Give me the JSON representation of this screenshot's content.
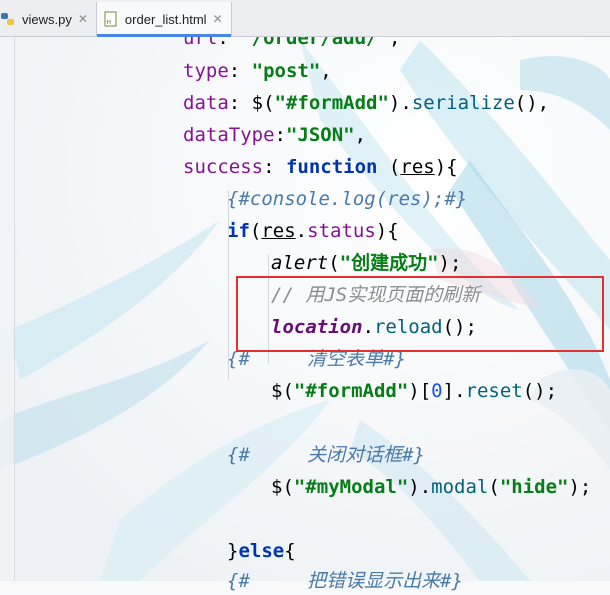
{
  "tabs": [
    {
      "label": "views.py",
      "icon": "python-file-icon",
      "active": false
    },
    {
      "label": "order_list.html",
      "icon": "html-file-icon",
      "active": true
    }
  ],
  "code": {
    "url_key": "url",
    "url_value": "\"/order/add/\"",
    "type_key": "type",
    "type_value": "\"post\"",
    "data_key": "data",
    "data_selector": "\"#formAdd\"",
    "serialize": "serialize",
    "datatype_key": "dataType",
    "datatype_value": "\"JSON\"",
    "success_key": "success",
    "function_kw": "function",
    "res_param": "res",
    "console_comment": "{#console.log(res);#}",
    "if_kw": "if",
    "res_status": "status",
    "alert_fn": "alert",
    "alert_msg": "\"创建成功\"",
    "js_comment": "// 用JS实现页面的刷新",
    "location": "location",
    "reload": "reload",
    "clear_comment": "{#     清空表单#}",
    "form_selector": "\"#formAdd\"",
    "index_zero": "0",
    "reset": "reset",
    "close_comment": "{#     关闭对话框#}",
    "modal_selector": "\"#myModal\"",
    "modal_fn": "modal",
    "modal_arg": "\"hide\"",
    "else_kw": "else",
    "error_comment": "{#     把错误显示出来#}"
  },
  "colors": {
    "highlight_box": "#e1312f",
    "active_tab_underline": "#4a86e8"
  }
}
